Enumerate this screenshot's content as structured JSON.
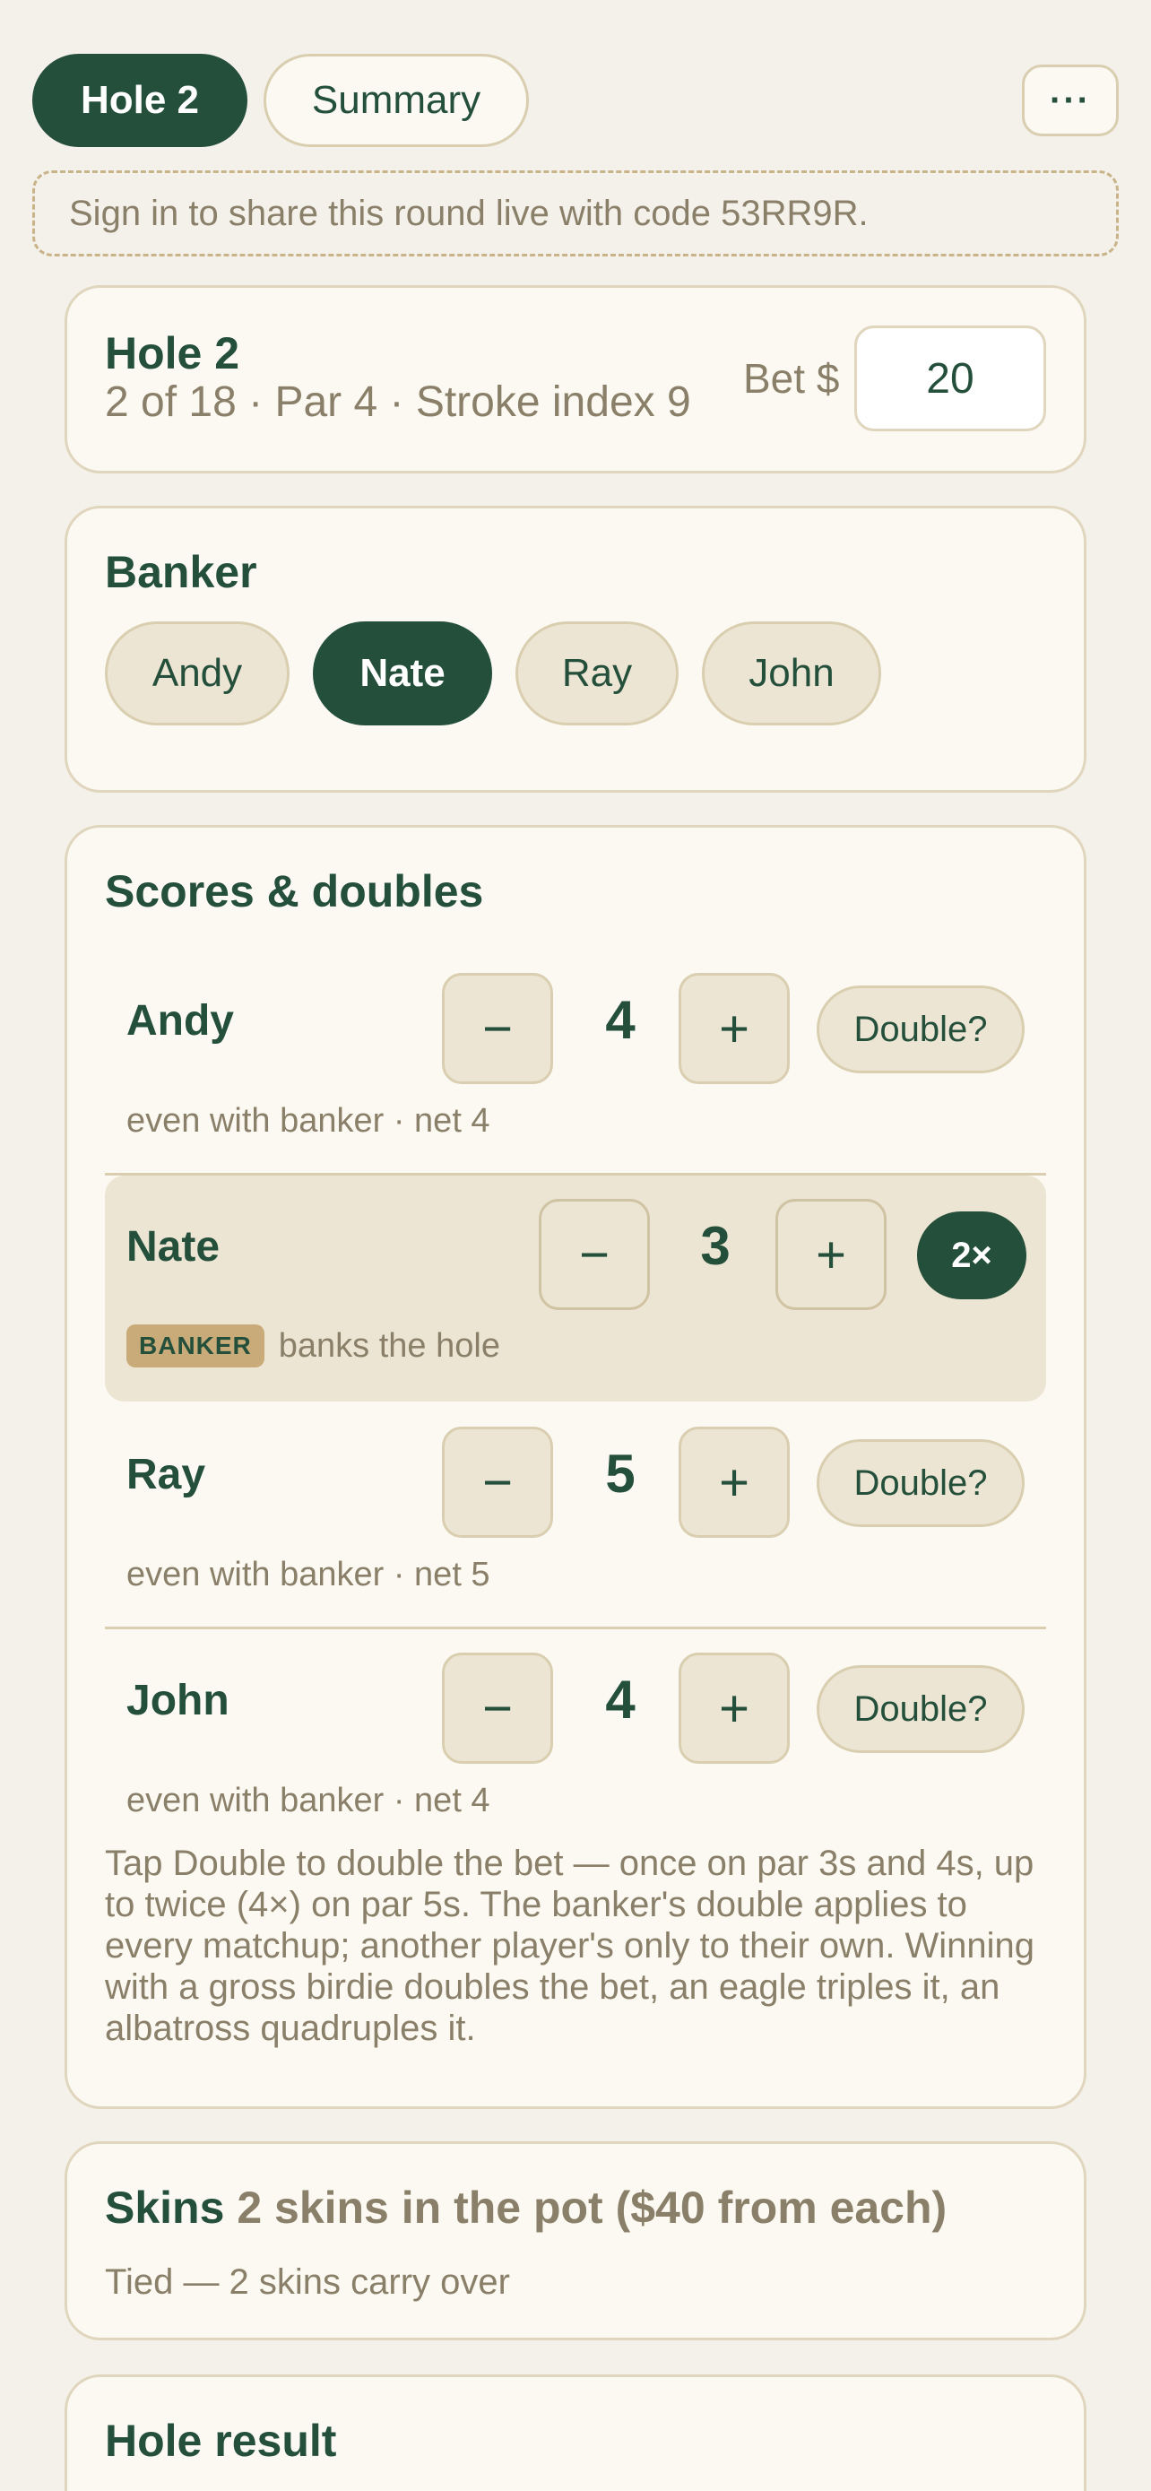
{
  "tabs": [
    {
      "label": "Hole 2",
      "active": true
    },
    {
      "label": "Summary",
      "active": false
    }
  ],
  "more_label": "···",
  "signin_text": "Sign in to share this round live with code 53RR9R.",
  "hole": {
    "title": "Hole 2",
    "subtitle": "2 of 18 · Par 4 · Stroke index 9",
    "bet_label": "Bet $",
    "bet_value": "20"
  },
  "banker": {
    "title": "Banker",
    "players": [
      "Andy",
      "Nate",
      "Ray",
      "John"
    ],
    "selected": "Nate"
  },
  "scores": {
    "title": "Scores & doubles",
    "minus": "−",
    "plus": "+",
    "rows": [
      {
        "name": "Andy",
        "score": "4",
        "double": "Double?",
        "note": "even with banker · net 4",
        "is_banker": false
      },
      {
        "name": "Nate",
        "score": "3",
        "double": "2×",
        "badge": "BANKER",
        "note": "banks the hole",
        "is_banker": true
      },
      {
        "name": "Ray",
        "score": "5",
        "double": "Double?",
        "note": "even with banker · net 5",
        "is_banker": false
      },
      {
        "name": "John",
        "score": "4",
        "double": "Double?",
        "note": "even with banker · net 4",
        "is_banker": false
      }
    ],
    "help": "Tap Double to double the bet — once on par 3s and 4s, up to twice (4×) on par 5s. The banker's double applies to every matchup; another player's only to their own. Winning with a gross birdie doubles the bet, an eagle triples it, an albatross quadruples it."
  },
  "skins": {
    "title": "Skins",
    "pot": "2 skins in the pot ($40 from each)",
    "status": "Tied — 2 skins carry over"
  },
  "result": {
    "title": "Hole result"
  },
  "colors": {
    "primary": "#244f3b",
    "background": "#f4f1ea",
    "card": "#fbf9f2",
    "chip": "#ede5d3",
    "muted": "#8a7f68",
    "badge": "#c9ab79"
  }
}
